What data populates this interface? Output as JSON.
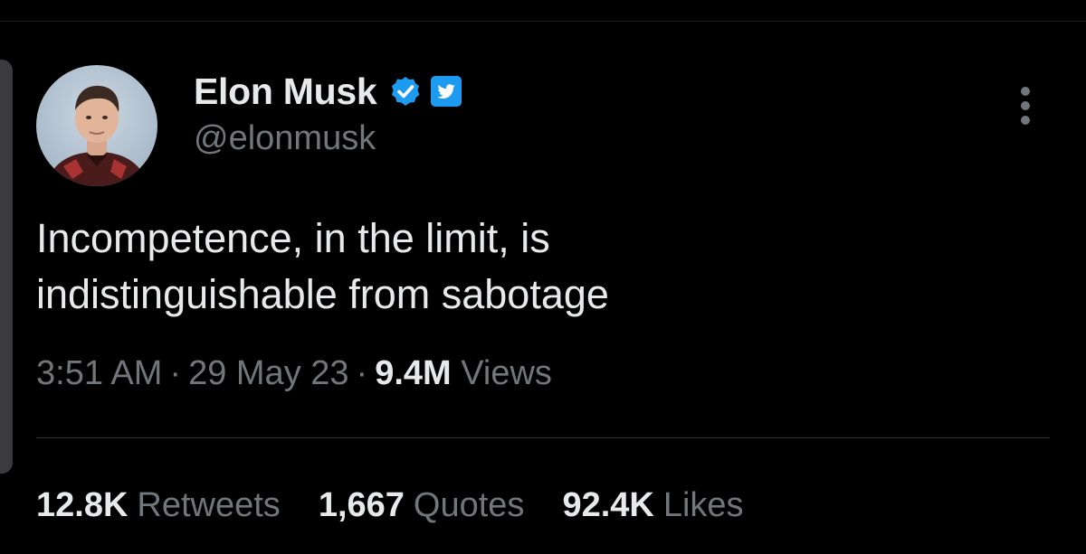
{
  "tweet": {
    "author": {
      "display_name": "Elon Musk",
      "handle": "@elonmusk",
      "verified": true
    },
    "text_lines": [
      "Incompetence, in the limit, is",
      "indistinguishable from sabotage"
    ],
    "time": "3:51 AM",
    "date": "29 May 23",
    "separator": "·",
    "views_count": "9.4M",
    "views_label": "Views",
    "stats": {
      "retweets": {
        "count": "12.8K",
        "label": "Retweets"
      },
      "quotes": {
        "count": "1,667",
        "label": "Quotes"
      },
      "likes": {
        "count": "92.4K",
        "label": "Likes"
      }
    }
  },
  "icons": {
    "verified": "verified-badge-icon",
    "twitter_badge": "twitter-bird-icon",
    "more": "more-options-icon"
  },
  "colors": {
    "background": "#000000",
    "primary_text": "#e7e9ea",
    "secondary_text": "#71767b",
    "accent_blue": "#1d9bf0"
  }
}
